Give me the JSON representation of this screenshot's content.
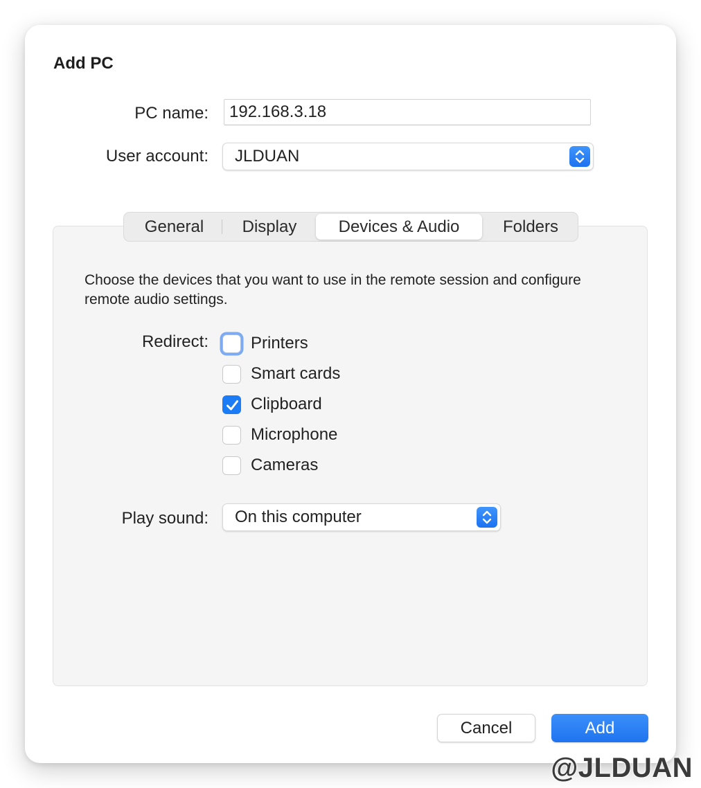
{
  "dialog": {
    "title": "Add PC"
  },
  "pc_name": {
    "label": "PC name:",
    "value": "192.168.3.18"
  },
  "user_account": {
    "label": "User account:",
    "value": "JLDUAN"
  },
  "tabs": [
    {
      "label": "General",
      "selected": false
    },
    {
      "label": "Display",
      "selected": false
    },
    {
      "label": "Devices & Audio",
      "selected": true
    },
    {
      "label": "Folders",
      "selected": false
    }
  ],
  "devices": {
    "description": "Choose the devices that you want to use in the remote session and configure remote audio settings.",
    "redirect_label": "Redirect:",
    "options": [
      {
        "label": "Printers",
        "checked": false,
        "focused": true
      },
      {
        "label": "Smart cards",
        "checked": false,
        "focused": false
      },
      {
        "label": "Clipboard",
        "checked": true,
        "focused": false
      },
      {
        "label": "Microphone",
        "checked": false,
        "focused": false
      },
      {
        "label": "Cameras",
        "checked": false,
        "focused": false
      }
    ],
    "play_sound_label": "Play sound:",
    "play_sound_value": "On this computer"
  },
  "buttons": {
    "cancel": "Cancel",
    "add": "Add"
  },
  "watermark": "@JLDUAN",
  "colors": {
    "accent": "#1c7cf5",
    "panel_bg": "#f5f5f5",
    "focus_ring": "#7eaaf0"
  },
  "icons": {
    "stepper": "up-down-chevrons-icon",
    "checkmark": "checkmark-icon"
  }
}
